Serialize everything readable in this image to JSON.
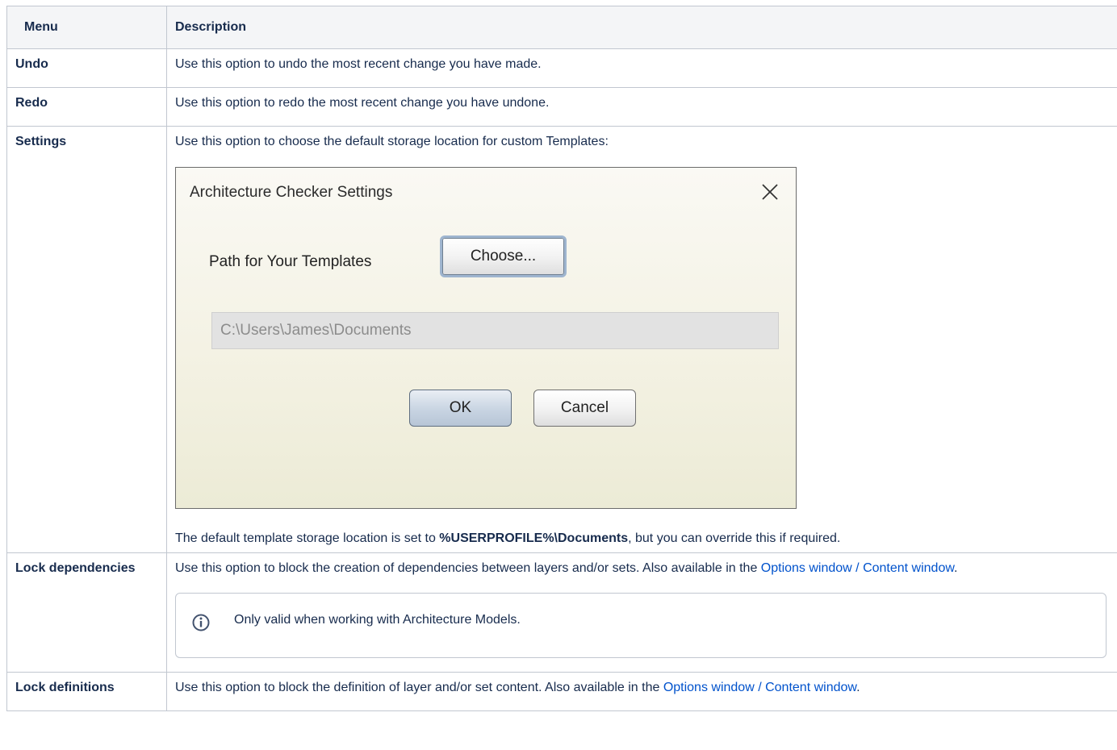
{
  "table": {
    "headers": {
      "menu": "Menu",
      "description": "Description"
    },
    "undo": {
      "menu": "Undo",
      "description": "Use this option to undo the most recent change you have made."
    },
    "redo": {
      "menu": "Redo",
      "description": "Use this option to redo the most recent change you have undone."
    },
    "settings": {
      "menu": "Settings",
      "description": "Use this option to choose the default storage location for custom Templates:",
      "note_before": "The default template storage location is set to ",
      "note_bold": "%USERPROFILE%\\Documents",
      "note_after": ", but you can override this if required."
    },
    "lock_dependencies": {
      "menu": "Lock dependencies",
      "description": "Use this option to block the creation of dependencies between layers and/or sets. Also available in the ",
      "link": "Options window / Content window",
      "description_end": ".",
      "info_text": "Only valid when working with Architecture Models.",
      "info_icon": "info-icon"
    },
    "lock_definitions": {
      "menu": "Lock definitions",
      "description": "Use this option to block the definition of layer and/or set content. Also available in the ",
      "link": "Options window / Content window",
      "description_end": "."
    }
  },
  "dialog": {
    "title": "Architecture Checker Settings",
    "close_icon": "close-icon",
    "path_label": "Path for Your Templates",
    "choose_button": "Choose...",
    "path_value": "C:\\Users\\James\\Documents",
    "ok_button": "OK",
    "cancel_button": "Cancel"
  },
  "colors": {
    "link": "#0052cc",
    "header_bg": "#f4f5f7",
    "border": "#c1c7d0",
    "text": "#172b4d"
  }
}
